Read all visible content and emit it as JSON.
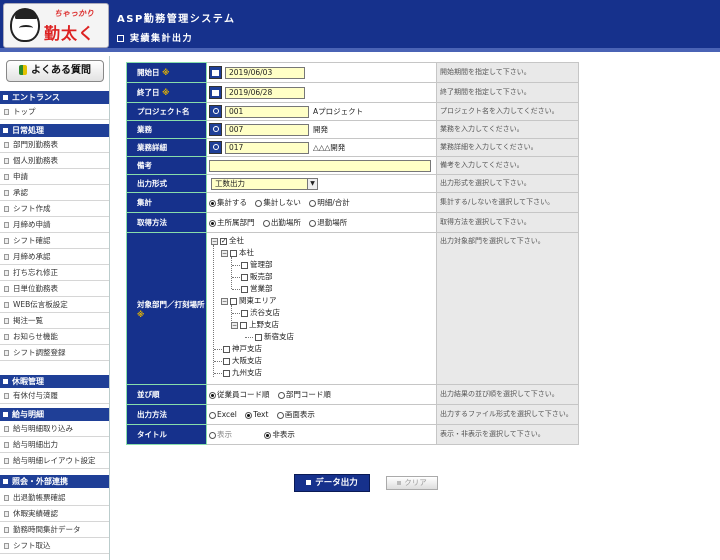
{
  "header": {
    "logo_small": "ちゃっかり",
    "logo_main": "勤太くん",
    "system_title": "ASP勤務管理システム",
    "page_title": "実績集計出力"
  },
  "sidebar": {
    "faq_label": "よくある質問",
    "sections": [
      {
        "title": "エントランス",
        "items": [
          "トップ"
        ]
      },
      {
        "title": "日常処理",
        "items": [
          "部門別勤務表",
          "個人別勤務表",
          "申請",
          "承認",
          "シフト作成",
          "月締め申請",
          "シフト確認",
          "月締め承認",
          "打ち忘れ修正",
          "日単位勤務表",
          "WEB伝言板設定",
          "掲注一覧",
          "お知らせ機能",
          "シフト調整登録"
        ]
      },
      {
        "title": "休暇管理",
        "items": [
          "有休付与済履"
        ]
      },
      {
        "title": "給与明細",
        "items": [
          "給与明細取り込み",
          "給与明細出力",
          "給与明細レイアウト設定"
        ]
      },
      {
        "title": "照会・外部連携",
        "items": [
          "出退勤帳票確認",
          "休暇実績確認",
          "勤務時間集計データ",
          "シフト取込"
        ]
      }
    ]
  },
  "form": {
    "required_mark": "※",
    "rows": {
      "start": {
        "label": "開始日",
        "value": "2019/06/03",
        "hint": "開始期間を指定して下さい。"
      },
      "end": {
        "label": "終了日",
        "value": "2019/06/28",
        "hint": "終了期間を指定して下さい。"
      },
      "project": {
        "label": "プロジェクト名",
        "value": "001",
        "after": "Aプロジェクト",
        "hint": "プロジェクト名を入力してください。"
      },
      "work": {
        "label": "業務",
        "value": "007",
        "after": "開発",
        "hint": "業務を入力してください。"
      },
      "work_detail": {
        "label": "業務詳細",
        "value": "017",
        "after": "△△△開発",
        "hint": "業務詳細を入力してください。"
      },
      "note": {
        "label": "備考",
        "value": "",
        "hint": "備考を入力してください。"
      },
      "output_format": {
        "label": "出力形式",
        "value": "工数出力",
        "hint": "出力形式を選択して下さい。"
      },
      "aggregate": {
        "label": "集計",
        "options": [
          "集計する",
          "集計しない",
          "明細/合計"
        ],
        "hint": "集計する/しないを選択して下さい。"
      },
      "acquire": {
        "label": "取得方法",
        "options": [
          "主所属部門",
          "出勤場所",
          "退勤場所"
        ],
        "hint": "取得方法を選択して下さい。"
      },
      "dept": {
        "label": "対象部門／打刻場所",
        "hint": "出力対象部門を選択して下さい。"
      },
      "sort": {
        "label": "並び順",
        "options": [
          "従業員コード順",
          "部門コード順"
        ],
        "hint": "出力結果の並び順を選択して下さい。"
      },
      "output_method": {
        "label": "出力方法",
        "options": [
          "Excel",
          "Text",
          "画面表示"
        ],
        "hint": "出力するファイル形式を選択して下さい。"
      },
      "title": {
        "label": "タイトル",
        "options": [
          "表示",
          "非表示"
        ],
        "hint": "表示・非表示を選択して下さい。"
      }
    },
    "tree": {
      "all": "全社",
      "honsha": "本社",
      "kanri": "管理部",
      "hanbai": "販売部",
      "eigyo": "営業部",
      "kanto": "関東エリア",
      "shibuya": "渋谷支店",
      "ueno": "上野支店",
      "shinjuku": "新宿支店",
      "kobe": "神戸支店",
      "osaka": "大阪支店",
      "kyushu": "九州支店"
    }
  },
  "buttons": {
    "export": "データ出力",
    "clear": "クリア"
  },
  "colors": {
    "navy": "#16318c",
    "input_bg": "#ffffc6",
    "hint_bg": "#e9e9e9"
  }
}
